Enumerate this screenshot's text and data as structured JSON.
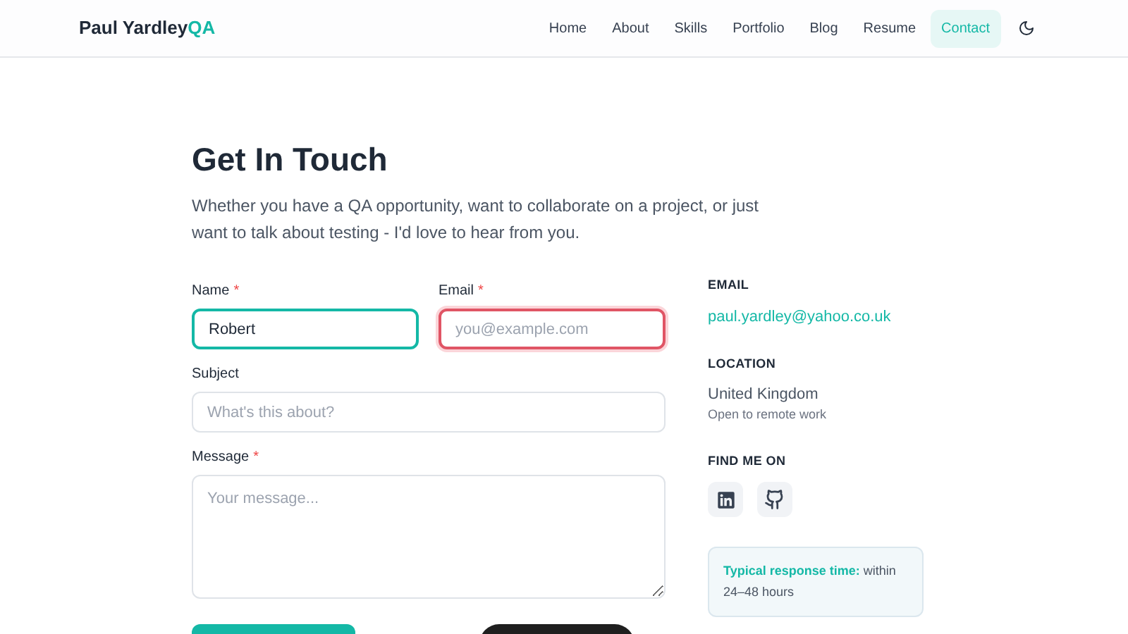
{
  "header": {
    "logo": "Paul Yardley",
    "logo_accent": "QA",
    "nav": [
      {
        "label": "Home",
        "selected": false
      },
      {
        "label": "About",
        "selected": false
      },
      {
        "label": "Skills",
        "selected": false
      },
      {
        "label": "Portfolio",
        "selected": false
      },
      {
        "label": "Blog",
        "selected": false
      },
      {
        "label": "Resume",
        "selected": false
      },
      {
        "label": "Contact",
        "selected": true
      }
    ]
  },
  "title": "Get In Touch",
  "intro": "Whether you have a QA opportunity, want to collaborate on a project, or just want to talk about testing - I'd love to hear from you.",
  "form": {
    "rows": [
      [
        {
          "kind": "input",
          "label": "Name",
          "required_mark": "*",
          "value": "Robert",
          "focused": true,
          "invalid": false
        },
        {
          "kind": "input",
          "label": "Email",
          "required_mark": "*",
          "placeholder": "you@example.com",
          "focused": false,
          "invalid": true
        }
      ],
      [
        {
          "kind": "input",
          "label": "Subject",
          "placeholder": "What's this about?",
          "focused": false,
          "invalid": false
        }
      ],
      [
        {
          "kind": "textarea",
          "label": "Message",
          "required_mark": "*",
          "placeholder": "Your message...",
          "focused": false,
          "invalid": false
        }
      ]
    ]
  },
  "sidebar": {
    "email_heading": "EMAIL",
    "email": "paul.yardley@yahoo.co.uk",
    "location_heading": "LOCATION",
    "location": "United Kingdom",
    "location_note": "Open to remote work",
    "social_heading": "FIND ME ON",
    "socials": [
      {
        "kind": "linkedin"
      },
      {
        "kind": "github"
      }
    ],
    "response_label": "Typical response time:",
    "response_text": "within 24–48 hours"
  }
}
